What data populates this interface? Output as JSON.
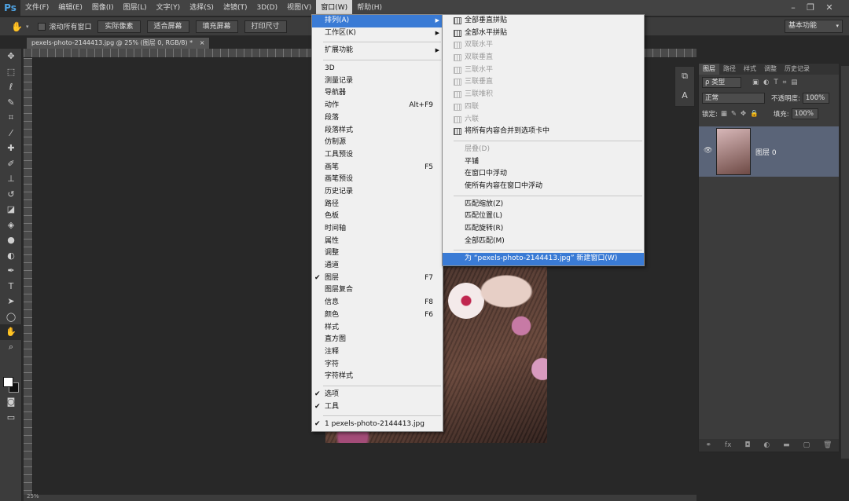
{
  "menubar": {
    "logo": "Ps",
    "items": [
      "文件(F)",
      "编辑(E)",
      "图像(I)",
      "图层(L)",
      "文字(Y)",
      "选择(S)",
      "滤镜(T)",
      "3D(D)",
      "视图(V)",
      "窗口(W)",
      "帮助(H)"
    ]
  },
  "options": {
    "scroll_all_label": "滚动所有窗口",
    "buttons": [
      "实际像素",
      "适合屏幕",
      "填充屏幕",
      "打印尺寸"
    ],
    "workspace": "基本功能"
  },
  "document": {
    "tab_title": "pexels-photo-2144413.jpg @ 25% (图层 0, RGB/8) *"
  },
  "window_menu": {
    "items": [
      {
        "label": "排列(A)",
        "arrow": true,
        "highlight": true
      },
      {
        "label": "工作区(K)",
        "arrow": true
      },
      {
        "sep": true
      },
      {
        "label": "扩展功能",
        "arrow": true
      },
      {
        "sep": true
      },
      {
        "label": "3D"
      },
      {
        "label": "测量记录"
      },
      {
        "label": "导航器"
      },
      {
        "label": "动作",
        "shortcut": "Alt+F9"
      },
      {
        "label": "段落"
      },
      {
        "label": "段落样式"
      },
      {
        "label": "仿制源"
      },
      {
        "label": "工具预设"
      },
      {
        "label": "画笔",
        "shortcut": "F5"
      },
      {
        "label": "画笔预设"
      },
      {
        "label": "历史记录"
      },
      {
        "label": "路径"
      },
      {
        "label": "色板"
      },
      {
        "label": "时间轴"
      },
      {
        "label": "属性"
      },
      {
        "label": "调整"
      },
      {
        "label": "通道"
      },
      {
        "label": "图层",
        "shortcut": "F7",
        "checked": true
      },
      {
        "label": "图层复合"
      },
      {
        "label": "信息",
        "shortcut": "F8"
      },
      {
        "label": "颜色",
        "shortcut": "F6"
      },
      {
        "label": "样式"
      },
      {
        "label": "直方图"
      },
      {
        "label": "注释"
      },
      {
        "label": "字符"
      },
      {
        "label": "字符样式"
      },
      {
        "sep": true
      },
      {
        "label": "选项",
        "checked": true
      },
      {
        "label": "工具",
        "checked": true
      },
      {
        "sep": true
      },
      {
        "label": "1 pexels-photo-2144413.jpg",
        "checked": true
      }
    ]
  },
  "arrange_submenu": {
    "items": [
      {
        "label": "全部垂直拼贴",
        "icon": true
      },
      {
        "label": "全部水平拼贴",
        "icon": true
      },
      {
        "label": "双联水平",
        "icon": true,
        "disabled": true
      },
      {
        "label": "双联垂直",
        "icon": true,
        "disabled": true
      },
      {
        "label": "三联水平",
        "icon": true,
        "disabled": true
      },
      {
        "label": "三联垂直",
        "icon": true,
        "disabled": true
      },
      {
        "label": "三联堆积",
        "icon": true,
        "disabled": true
      },
      {
        "label": "四联",
        "icon": true,
        "disabled": true
      },
      {
        "label": "六联",
        "icon": true,
        "disabled": true
      },
      {
        "label": "将所有内容合并到选项卡中",
        "icon": true
      },
      {
        "sep": true
      },
      {
        "label": "层叠(D)",
        "disabled": true
      },
      {
        "label": "平铺"
      },
      {
        "label": "在窗口中浮动"
      },
      {
        "label": "使所有内容在窗口中浮动"
      },
      {
        "sep": true
      },
      {
        "label": "匹配缩放(Z)"
      },
      {
        "label": "匹配位置(L)"
      },
      {
        "label": "匹配旋转(R)"
      },
      {
        "label": "全部匹配(M)"
      },
      {
        "sep": true
      },
      {
        "label": "为 “pexels-photo-2144413.jpg” 新建窗口(W)",
        "highlight": true
      }
    ]
  },
  "layers_panel": {
    "tabs": [
      "图层",
      "路径",
      "样式",
      "调整",
      "历史记录"
    ],
    "filter_label": "ρ 类型",
    "blend_mode": "正常",
    "opacity_label": "不透明度:",
    "opacity_value": "100%",
    "lock_label": "锁定:",
    "fill_label": "填充:",
    "fill_value": "100%",
    "layer_name": "图层 0"
  },
  "status": {
    "zoom": "25%"
  }
}
